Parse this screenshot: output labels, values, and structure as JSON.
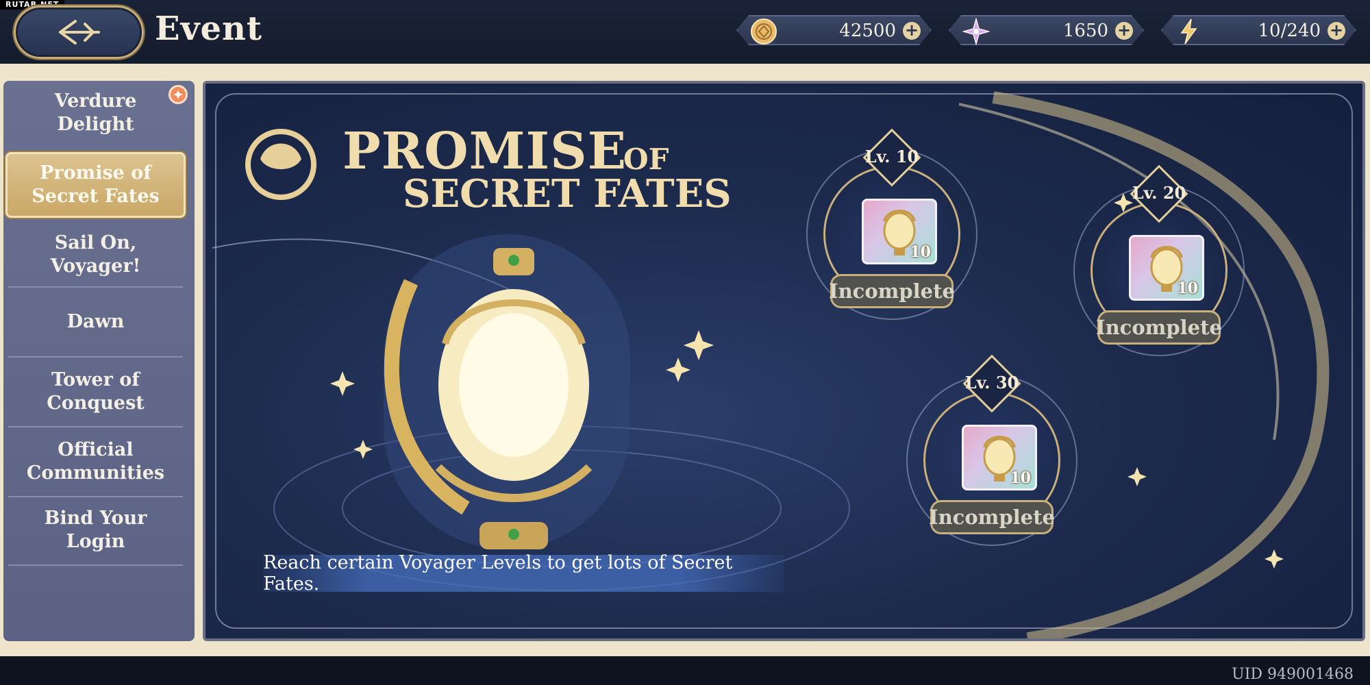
{
  "watermark": "RUTAB.NET",
  "header": {
    "title": "Event",
    "currencies": [
      {
        "icon": "coin-icon",
        "value": "42500"
      },
      {
        "icon": "star-crystal-icon",
        "value": "1650"
      },
      {
        "icon": "lightning-icon",
        "value": "10/240"
      }
    ]
  },
  "sidebar": {
    "items": [
      {
        "label": "Verdure Delight",
        "active": false
      },
      {
        "label": "Promise of Secret Fates",
        "active": true
      },
      {
        "label": "Sail On, Voyager!",
        "active": false
      },
      {
        "label": "Dawn",
        "active": false
      },
      {
        "label": "Tower of Conquest",
        "active": false
      },
      {
        "label": "Official Communities",
        "active": false
      },
      {
        "label": "Bind Your Login",
        "active": false
      }
    ]
  },
  "banner": {
    "title_line1": "PROMISE",
    "title_of": "OF",
    "title_line2": "SECRET FATES",
    "caption": "Reach certain Voyager Levels to get lots of Secret Fates.",
    "rewards": [
      {
        "level": "Lv. 10",
        "quantity": "10",
        "status": "Incomplete"
      },
      {
        "level": "Lv. 20",
        "quantity": "10",
        "status": "Incomplete"
      },
      {
        "level": "Lv. 30",
        "quantity": "10",
        "status": "Incomplete"
      }
    ]
  },
  "footer": {
    "uid": "UID 949001468"
  },
  "colors": {
    "gold": "#e4cf9d",
    "navy": "#1d2b4e",
    "cream": "#eee4cc",
    "sidebar": "#626889"
  }
}
